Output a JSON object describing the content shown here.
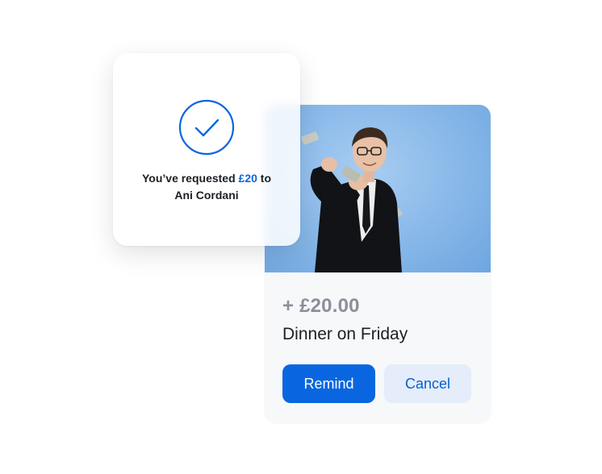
{
  "confirmation": {
    "message_prefix": "You’ve requested",
    "amount": "£20",
    "message_middle": "to",
    "recipient": "Ani Cordani",
    "icon": "check-circle-icon"
  },
  "request": {
    "image": "man-throwing-money-photo",
    "amount": "+ £20.00",
    "description": "Dinner on Friday",
    "remind_label": "Remind",
    "cancel_label": "Cancel"
  },
  "colors": {
    "accent": "#0a66e0",
    "secondary_button_bg": "#e4edf9",
    "amount_gray": "#8a9099",
    "photo_bg": "#8dbbea"
  }
}
